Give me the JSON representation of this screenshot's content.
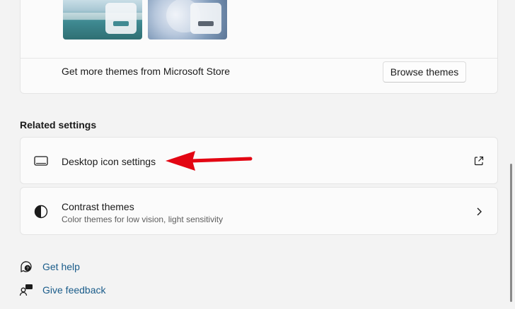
{
  "themes": {
    "store_label": "Get more themes from Microsoft Store",
    "browse_button": "Browse themes",
    "thumbnails": [
      {
        "name": "glow-lake-theme",
        "accent": "#3f8a92"
      },
      {
        "name": "bloom-theme",
        "accent": "#5b6470"
      }
    ]
  },
  "related": {
    "heading": "Related settings",
    "items": [
      {
        "title": "Desktop icon settings",
        "icon": "monitor-icon",
        "trail_icon": "open-external-icon"
      },
      {
        "title": "Contrast themes",
        "subtitle": "Color themes for low vision, light sensitivity",
        "icon": "contrast-icon",
        "trail_icon": "chevron-right-icon"
      }
    ]
  },
  "help_links": [
    {
      "label": "Get help",
      "icon": "help-icon"
    },
    {
      "label": "Give feedback",
      "icon": "feedback-icon"
    }
  ],
  "colors": {
    "link": "#1a5c8a",
    "annotation_arrow": "#e30613"
  }
}
